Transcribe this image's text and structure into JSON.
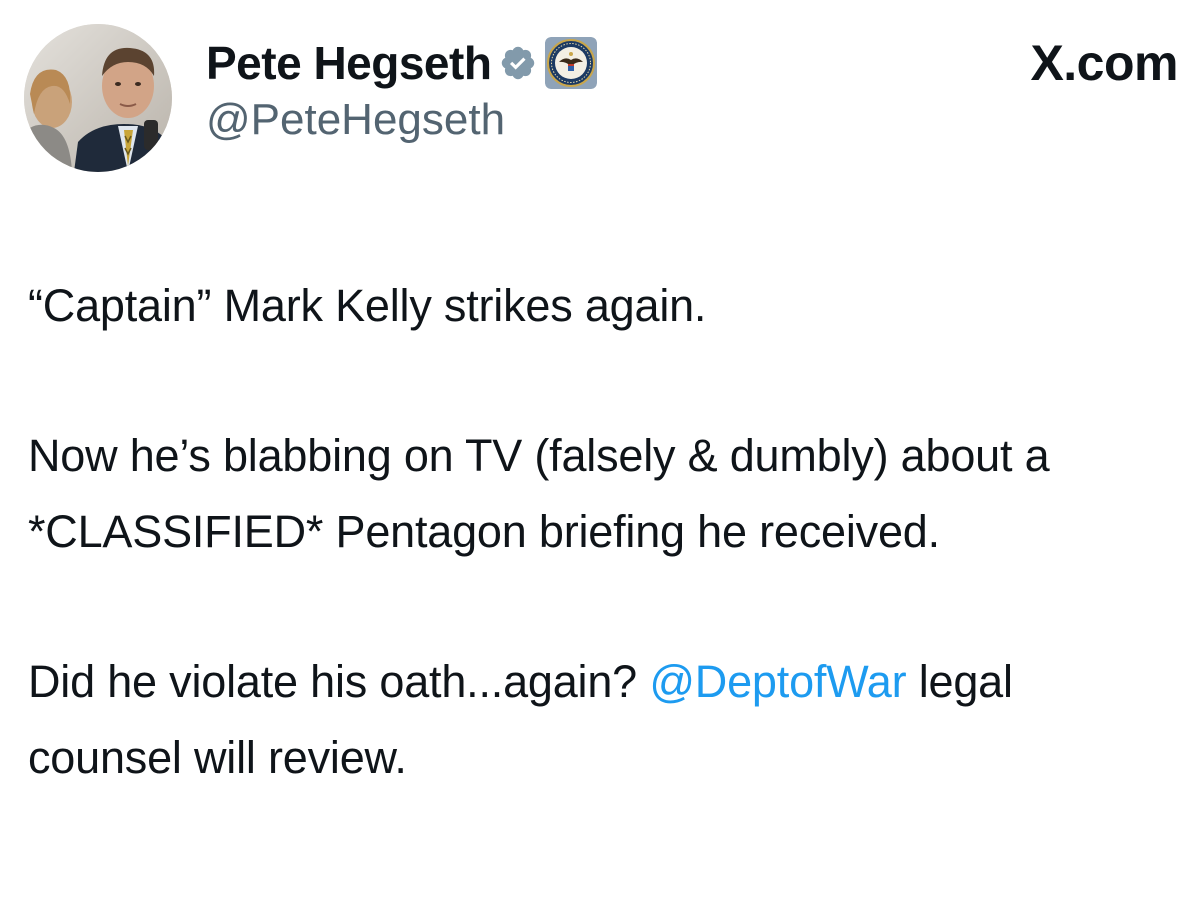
{
  "header": {
    "display_name": "Pete Hegseth",
    "handle": "@PeteHegseth",
    "site_label": "X.com",
    "verified_icon": "verified-check-icon",
    "affiliation_icon": "department-seal-icon",
    "accent_color": "#1d9bf0",
    "verified_color": "#829aab"
  },
  "tweet": {
    "paragraph_1": "“Captain” Mark Kelly strikes again.",
    "paragraph_2": "Now he’s blabbing on TV (falsely & dumbly) about a *CLASSIFIED* Pentagon briefing he received.",
    "paragraph_3_prefix": "Did he violate his oath...again? ",
    "mention": "@DeptofWar",
    "paragraph_3_suffix": " legal counsel will review."
  }
}
